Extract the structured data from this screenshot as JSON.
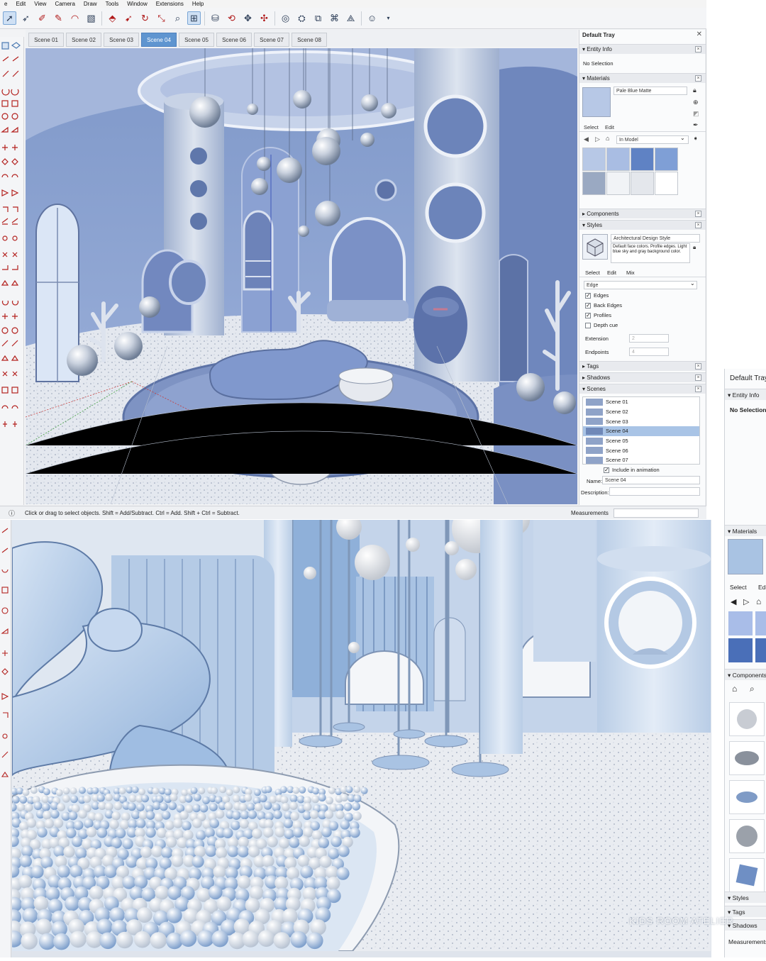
{
  "menu": [
    "e",
    "Edit",
    "View",
    "Camera",
    "Draw",
    "Tools",
    "Window",
    "Extensions",
    "Help"
  ],
  "scenes": {
    "tabs": [
      "Scene 01",
      "Scene 02",
      "Scene 03",
      "Scene 04",
      "Scene 05",
      "Scene 06",
      "Scene 07",
      "Scene 08"
    ],
    "active": "Scene 04"
  },
  "status": {
    "hint": "Click or drag to select objects. Shift = Add/Subtract. Ctrl = Add. Shift + Ctrl = Subtract.",
    "measurements_label": "Measurements"
  },
  "tray": {
    "title": "Default Tray",
    "entity_info": {
      "header": "Entity Info",
      "value": "No Selection"
    },
    "materials": {
      "header": "Materials",
      "name": "Pale Blue Matte",
      "select_tab": "Select",
      "edit_tab": "Edit",
      "library": "In Model",
      "swatches": [
        "#b7c8e6",
        "#a9bde3",
        "#5f82c4",
        "#7f9fd6",
        "#9aa9c2",
        "#f1f3f6",
        "#e4e7ec",
        "#ffffff"
      ]
    },
    "components": {
      "header": "Components"
    },
    "styles": {
      "header": "Styles",
      "style_name": "Architectural Design Style",
      "style_desc": "Default face colors. Profile edges. Light blue sky and gray background color.",
      "tabs": [
        "Select",
        "Edit",
        "Mix"
      ],
      "dropdown": "Edge",
      "options": [
        {
          "label": "Edges",
          "checked": true
        },
        {
          "label": "Back Edges",
          "checked": true
        },
        {
          "label": "Profiles",
          "checked": true
        },
        {
          "label": "Depth cue",
          "checked": false
        }
      ],
      "extension_label": "Extension",
      "extension_value": "2",
      "endpoints_label": "Endpoints",
      "endpoints_value": "4"
    },
    "tags": {
      "header": "Tags"
    },
    "shadows": {
      "header": "Shadows"
    },
    "scenes_panel": {
      "header": "Scenes",
      "list": [
        "Scene 01",
        "Scene 02",
        "Scene 03",
        "Scene 04",
        "Scene 05",
        "Scene 06",
        "Scene 07"
      ],
      "selected": "Scene 04",
      "include_label": "Include in animation",
      "name_label": "Name:",
      "name_value": "Scene 04",
      "description_label": "Description:"
    }
  },
  "tray2": {
    "title": "Default Tray",
    "entity_info": "Entity Info",
    "no_selection": "No Selection",
    "materials": "Materials",
    "select": "Select",
    "edit": "Edi",
    "components": "Components",
    "styles": "Styles",
    "tags": "Tags",
    "shadows": "Shadows",
    "measurements": "Measurements"
  },
  "watermark": "KIDS ROOM ATELIER",
  "colors": {
    "accent": "#5f95d0",
    "scene_blue": "#8fa7d4",
    "slide_blue": "#a9c3e3"
  }
}
